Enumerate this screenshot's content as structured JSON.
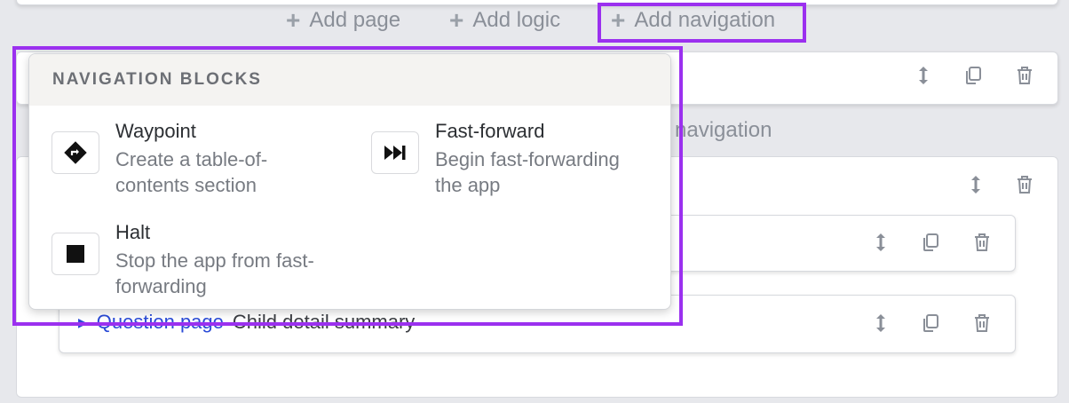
{
  "toolbar": {
    "add_page": "Add page",
    "add_logic": "Add logic",
    "add_navigation": "Add navigation"
  },
  "background": {
    "ghost_add_navigation": "d navigation",
    "question_page_type": "Question page",
    "question_page_title": "Child detail summary"
  },
  "menu": {
    "header": "NAVIGATION BLOCKS",
    "items": [
      {
        "title": "Waypoint",
        "desc_line1": "Create a table-of-",
        "desc_line2": "contents section",
        "icon": "waypoint-icon"
      },
      {
        "title": "Fast-forward",
        "desc_line1": "Begin fast-forwarding",
        "desc_line2": "the app",
        "icon": "fast-forward-icon"
      },
      {
        "title": "Halt",
        "desc_line1": "Stop the app from fast-",
        "desc_line2": "forwarding",
        "icon": "stop-icon"
      }
    ]
  },
  "colors": {
    "highlight": "#9b30ef",
    "link": "#2a4bd7",
    "muted_text": "#777b82"
  }
}
